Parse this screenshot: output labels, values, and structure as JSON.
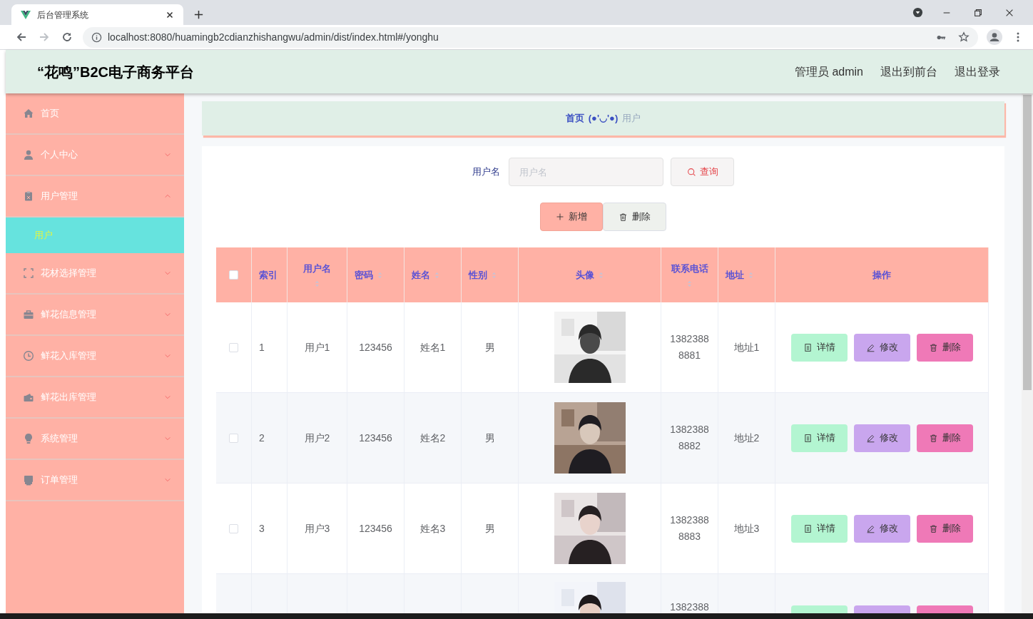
{
  "browser": {
    "tab_title": "后台管理系统",
    "url": "localhost:8080/huamingb2cdianzhishangwu/admin/dist/index.html#/yonghu"
  },
  "header": {
    "title": "“花鸣”B2C电子商务平台",
    "links": [
      "管理员 admin",
      "退出到前台",
      "退出登录"
    ]
  },
  "sidebar": {
    "items": [
      {
        "kind": "link",
        "label": "首页"
      },
      {
        "kind": "submenu",
        "label": "个人中心",
        "expanded": false
      },
      {
        "kind": "submenu",
        "label": "用户管理",
        "expanded": true,
        "children": [
          {
            "label": "用户",
            "selected": true
          }
        ]
      },
      {
        "kind": "submenu",
        "label": "花材选择管理",
        "expanded": false
      },
      {
        "kind": "submenu",
        "label": "鲜花信息管理",
        "expanded": false
      },
      {
        "kind": "submenu",
        "label": "鲜花入库管理",
        "expanded": false
      },
      {
        "kind": "submenu",
        "label": "鲜花出库管理",
        "expanded": false
      },
      {
        "kind": "submenu",
        "label": "系统管理",
        "expanded": false
      },
      {
        "kind": "submenu",
        "label": "订单管理",
        "expanded": false
      }
    ]
  },
  "breadcrumb": {
    "home": "首页",
    "separator": "(●'◡'●)",
    "current": "用户"
  },
  "search": {
    "label": "用户名",
    "placeholder": "用户名",
    "button": "查询"
  },
  "toolbar": {
    "add": "新增",
    "delete": "删除"
  },
  "table": {
    "select_all": {
      "checked": false
    },
    "columns": [
      {
        "label": "索引",
        "sortable": false
      },
      {
        "label": "用户名",
        "sortable": true
      },
      {
        "label": "密码",
        "sortable": true
      },
      {
        "label": "姓名",
        "sortable": true
      },
      {
        "label": "性别",
        "sortable": true
      },
      {
        "label": "头像",
        "sortable": true
      },
      {
        "label": "联系电话",
        "sortable": true
      },
      {
        "label": "地址",
        "sortable": true
      },
      {
        "label": "操作",
        "sortable": false
      }
    ],
    "rows": [
      {
        "checked": false,
        "cells": [
          "1",
          "用户1",
          "123456",
          "姓名1",
          "男"
        ],
        "phone": "13823888881",
        "address": "地址1",
        "actions": [
          "详情",
          "修改",
          "删除"
        ]
      },
      {
        "checked": false,
        "cells": [
          "2",
          "用户2",
          "123456",
          "姓名2",
          "男"
        ],
        "phone": "13823888882",
        "address": "地址2",
        "actions": [
          "详情",
          "修改",
          "删除"
        ]
      },
      {
        "checked": false,
        "cells": [
          "3",
          "用户3",
          "123456",
          "姓名3",
          "男"
        ],
        "phone": "13823888883",
        "address": "地址3",
        "actions": [
          "详情",
          "修改",
          "删除"
        ]
      }
    ],
    "cut_row": {
      "phone": "1382388"
    }
  }
}
